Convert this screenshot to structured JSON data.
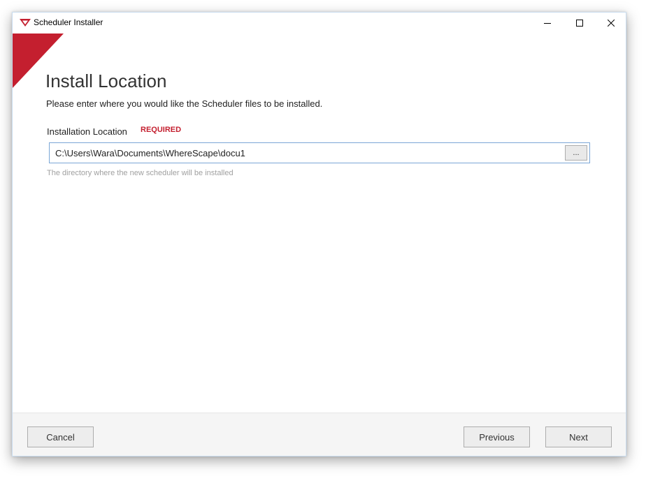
{
  "window": {
    "title": "Scheduler Installer",
    "icon": "scheduler-app-icon",
    "controls": {
      "minimize_icon": "minimize-icon",
      "maximize_icon": "maximize-icon",
      "close_icon": "close-icon"
    }
  },
  "page": {
    "title": "Install Location",
    "subtitle": "Please enter where you would like the Scheduler files to be installed."
  },
  "location_field": {
    "label": "Installation Location",
    "required_label": "REQUIRED",
    "value": "C:\\Users\\Wara\\Documents\\WhereScape\\docu1",
    "browse_label": "...",
    "helper": "The directory where the new scheduler will be installed"
  },
  "footer": {
    "cancel_label": "Cancel",
    "previous_label": "Previous",
    "next_label": "Next"
  },
  "colors": {
    "accent_red": "#c41f2f",
    "input_border": "#7aa6d6",
    "footer_background": "#f5f5f5"
  }
}
